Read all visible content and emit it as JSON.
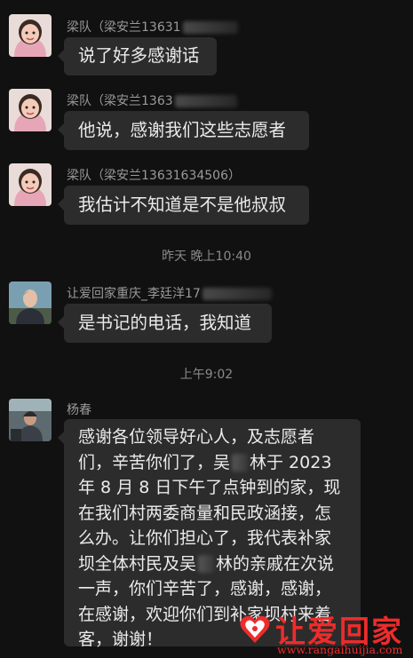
{
  "messages": [
    {
      "sender": "梁队（梁安兰13631",
      "text": "说了好多感谢话"
    },
    {
      "sender": "梁队（梁安兰1363",
      "text": "他说，感谢我们这些志愿者"
    },
    {
      "sender": "梁队（梁安兰13631634506）",
      "text": "我估计不知道是不是他叔叔"
    },
    {
      "sender": "让爱回家重庆_李廷洋17",
      "text": "是书记的电话，我知道"
    },
    {
      "sender": "杨春",
      "lines": [
        "感谢各位领导好心人，及志愿者",
        "们，辛苦你们了，吴",
        "林于 2023",
        "年 8 月 8 日下午了点钟到的家，现",
        "在我们村两委商量和民政涵接，怎",
        "么办。让你们担心了，我代表补家",
        "坝全体村民及吴",
        "林的亲戚在次说",
        "一声，你们辛苦了，感谢，感谢，",
        "在感谢，欢迎你们到补家坝村来着",
        "客，谢谢！"
      ]
    }
  ],
  "timestamps": [
    "昨天 晚上10:40",
    "上午9:02"
  ],
  "watermark": {
    "title": "让爱回家",
    "url": "www.rangaihuijia.com"
  },
  "colors": {
    "background": "#111111",
    "bubble": "#2c2c2c",
    "watermark": "#ef2b2b"
  }
}
